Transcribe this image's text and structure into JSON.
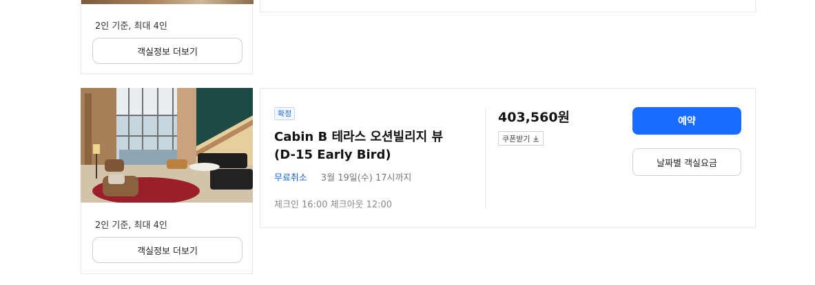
{
  "rooms": [
    {
      "capacity": "2인 기준, 최대 4인",
      "more_info_label": "객실정보 더보기"
    },
    {
      "capacity": "2인 기준, 최대 4인",
      "more_info_label": "객실정보 더보기",
      "badge": "확정",
      "name": "Cabin B 테라스 오션빌리지 뷰(D-15 Early Bird)",
      "cancel_policy": "무료취소",
      "cancel_deadline": "3월 19일(수) 17시까지",
      "checkin_checkout": "체크인 16:00 체크아웃 12:00",
      "price": "403,560원",
      "coupon_label": "쿠폰받기",
      "reserve_label": "예약",
      "date_rate_label": "날짜별 객실요금"
    }
  ],
  "colors": {
    "primary": "#1a6cff",
    "link_blue": "#1a66d9",
    "border": "#e6e6e6"
  }
}
